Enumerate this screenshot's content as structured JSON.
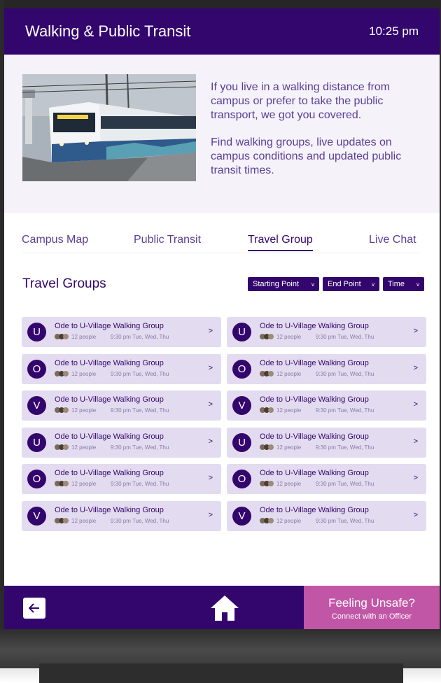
{
  "header": {
    "title": "Walking & Public Transit",
    "time": "10:25 pm"
  },
  "hero": {
    "paragraph_1": "If you live in a walking distance from campus or prefer to take the public transport, we got you covered.",
    "paragraph_2": "Find walking groups, live updates on campus conditions and updated public transit times."
  },
  "tabs": [
    "Campus Map",
    "Public Transit",
    "Travel Group",
    "Live Chat"
  ],
  "active_tab": "Travel Group",
  "section": {
    "title": "Travel Groups"
  },
  "filters": [
    "Starting Point",
    "End Point",
    "Time"
  ],
  "groups": [
    {
      "initial": "U",
      "title": "Ode to U-Village Walking Group",
      "people": "12 people",
      "schedule": "9:30 pm Tue, Wed, Thu"
    },
    {
      "initial": "U",
      "title": "Ode to U-Village Walking Group",
      "people": "12 people",
      "schedule": "9:30 pm Tue, Wed, Thu"
    },
    {
      "initial": "O",
      "title": "Ode to U-Village Walking Group",
      "people": "12 people",
      "schedule": "9:30 pm Tue, Wed, Thu"
    },
    {
      "initial": "O",
      "title": "Ode to U-Village Walking Group",
      "people": "12 people",
      "schedule": "9:30 pm Tue, Wed, Thu"
    },
    {
      "initial": "V",
      "title": "Ode to U-Village Walking Group",
      "people": "12 people",
      "schedule": "9:30 pm Tue, Wed, Thu"
    },
    {
      "initial": "V",
      "title": "Ode to U-Village Walking Group",
      "people": "12 people",
      "schedule": "9:30 pm Tue, Wed, Thu"
    },
    {
      "initial": "U",
      "title": "Ode to U-Village Walking Group",
      "people": "12 people",
      "schedule": "9:30 pm Tue, Wed, Thu"
    },
    {
      "initial": "U",
      "title": "Ode to U-Village Walking Group",
      "people": "12 people",
      "schedule": "9:30 pm Tue, Wed, Thu"
    },
    {
      "initial": "O",
      "title": "Ode to U-Village Walking Group",
      "people": "12 people",
      "schedule": "9:30 pm Tue, Wed, Thu"
    },
    {
      "initial": "O",
      "title": "Ode to U-Village Walking Group",
      "people": "12 people",
      "schedule": "9:30 pm Tue, Wed, Thu"
    },
    {
      "initial": "V",
      "title": "Ode to U-Village Walking Group",
      "people": "12 people",
      "schedule": "9:30 pm Tue, Wed, Thu"
    },
    {
      "initial": "V",
      "title": "Ode to U-Village Walking Group",
      "people": "12 people",
      "schedule": "9:30 pm Tue, Wed, Thu"
    }
  ],
  "group_chevron": ">",
  "footer": {
    "back_icon": "arrow-left-icon",
    "home_icon": "home-icon",
    "unsafe_title": "Feeling Unsafe?",
    "unsafe_subtitle": "Connect with an Officer"
  },
  "colors": {
    "primary": "#33066e",
    "accent": "#c256a6",
    "card": "#e3dbef",
    "hero_bg": "#f5f2fa"
  }
}
